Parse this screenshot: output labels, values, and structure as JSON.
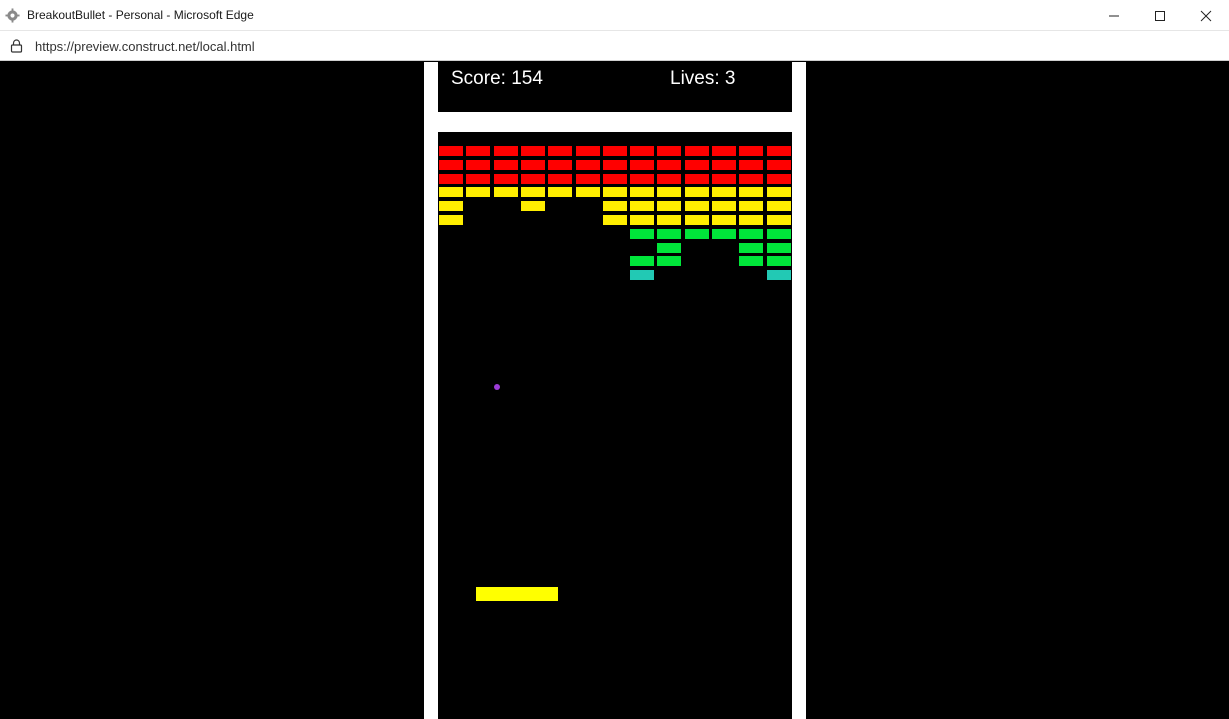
{
  "window": {
    "title": "BreakoutBullet - Personal - Microsoft Edge",
    "url": "https://preview.construct.net/local.html"
  },
  "hud": {
    "score_text": "Score: 154",
    "lives_text": "Lives: 3"
  },
  "game": {
    "score": 154,
    "lives": 3,
    "columns": 13,
    "colors": {
      "R": "#ff0000",
      "Y": "#ffee00",
      "G": "#00e63a",
      "C": "#22c9b4",
      "ball": "#9b3bd6",
      "paddle": "#ffff00"
    },
    "brick_rows": [
      "RRRRRRRRRRRRR",
      "RRRRRRRRRRRRR",
      "RRRRRRRRRRRRR",
      "YYYYYYYYYYYYY",
      "Y..Y..YYYYYYY",
      "Y.....YYYYYYY",
      ".......GGGGGG",
      "........G..GG",
      ".......GG..GG",
      ".......C....C"
    ]
  }
}
